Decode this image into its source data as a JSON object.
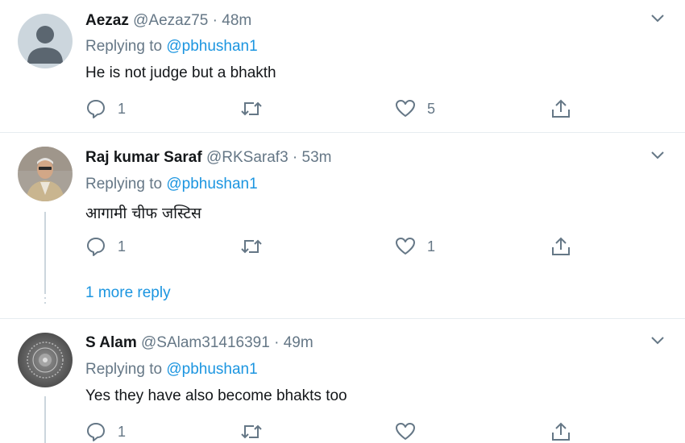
{
  "tweets": [
    {
      "name": "Aezaz",
      "handle": "@Aezaz75",
      "separator": "·",
      "time": "48m",
      "replying_prefix": "Replying to",
      "replying_to": "@pbhushan1",
      "text": "He is not judge but a bhakth",
      "reply_count": "1",
      "retweet_count": "",
      "like_count": "5",
      "avatar": "default-person-avatar"
    },
    {
      "name": "Raj kumar Saraf",
      "handle": "@RKSaraf3",
      "separator": "·",
      "time": "53m",
      "replying_prefix": "Replying to",
      "replying_to": "@pbhushan1",
      "text": "आगामी चीफ जस्टिस",
      "reply_count": "1",
      "retweet_count": "",
      "like_count": "1",
      "avatar": "photo-avatar"
    },
    {
      "name": "S Alam",
      "handle": "@SAlam31416391",
      "separator": "·",
      "time": "49m",
      "replying_prefix": "Replying to",
      "replying_to": "@pbhushan1",
      "text": "Yes they have also become bhakts too",
      "reply_count": "1",
      "retweet_count": "",
      "like_count": "",
      "avatar": "emblem-avatar"
    }
  ],
  "thread": {
    "more_reply_label": "1 more reply"
  },
  "icons": {
    "reply": "reply-icon",
    "retweet": "retweet-icon",
    "like": "heart-icon",
    "share": "share-icon",
    "menu": "chevron-down-icon"
  },
  "colors": {
    "link": "#1b95e0",
    "muted": "#657786",
    "border": "#e6ecf0"
  }
}
